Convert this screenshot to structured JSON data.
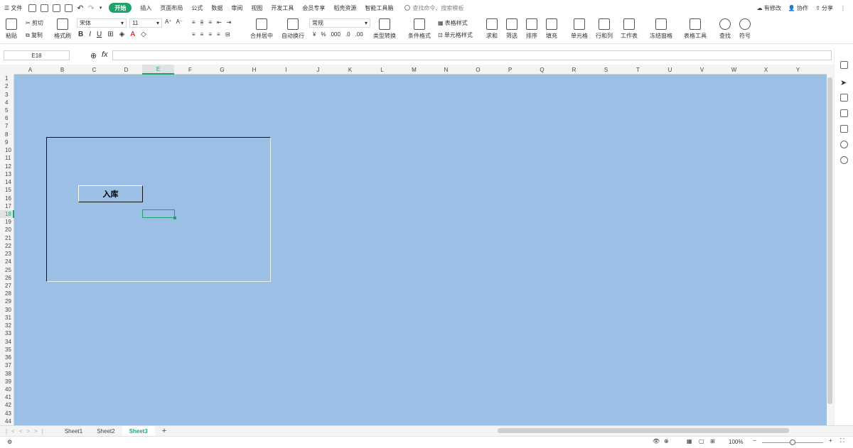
{
  "menubar": {
    "file": "文件",
    "tabs": [
      "开始",
      "插入",
      "页面布局",
      "公式",
      "数据",
      "审阅",
      "视图",
      "开发工具",
      "会员专享",
      "稻壳资源",
      "智能工具箱"
    ],
    "active_tab": "开始",
    "search": "查找命令、搜索模板",
    "modified": "有修改",
    "collab": "协作",
    "share": "分享"
  },
  "ribbon": {
    "paste": "粘贴",
    "cut": "剪切",
    "copy": "复制",
    "format_painter": "格式刷",
    "font": "宋体",
    "font_size": "11",
    "merge": "合并居中",
    "wrap": "自动换行",
    "number_format": "常规",
    "type_convert": "类型转换",
    "cond_format": "条件格式",
    "table_style": "表格样式",
    "cell_style": "单元格样式",
    "sum": "求和",
    "filter": "筛选",
    "sort": "排序",
    "fill": "填充",
    "cell": "单元格",
    "rowcol": "行和列",
    "sheet": "工作表",
    "freeze": "冻结窗格",
    "table_tools": "表格工具",
    "find": "查找",
    "symbol": "符号"
  },
  "formula": {
    "cell_ref": "E18",
    "fx": "fx",
    "value": ""
  },
  "columns": [
    "A",
    "B",
    "C",
    "D",
    "E",
    "F",
    "G",
    "H",
    "I",
    "J",
    "K",
    "L",
    "M",
    "N",
    "O",
    "P",
    "Q",
    "R",
    "S",
    "T",
    "U",
    "V",
    "W",
    "X",
    "Y"
  ],
  "active_column": "E",
  "rows": [
    "1",
    "2",
    "3",
    "4",
    "5",
    "6",
    "7",
    "8",
    "9",
    "10",
    "11",
    "12",
    "13",
    "14",
    "15",
    "16",
    "17",
    "18",
    "19",
    "20",
    "21",
    "22",
    "23",
    "24",
    "25",
    "26",
    "27",
    "28",
    "29",
    "30",
    "31",
    "32",
    "33",
    "34",
    "35",
    "36",
    "37",
    "38",
    "39",
    "40",
    "41",
    "42",
    "43",
    "44"
  ],
  "active_row": "18",
  "sheet": {
    "button_label": "入库",
    "background": "#9bbfe5"
  },
  "sheets": [
    "Sheet1",
    "Sheet2",
    "Sheet3"
  ],
  "active_sheet": "Sheet3",
  "status": {
    "zoom": "100%"
  }
}
